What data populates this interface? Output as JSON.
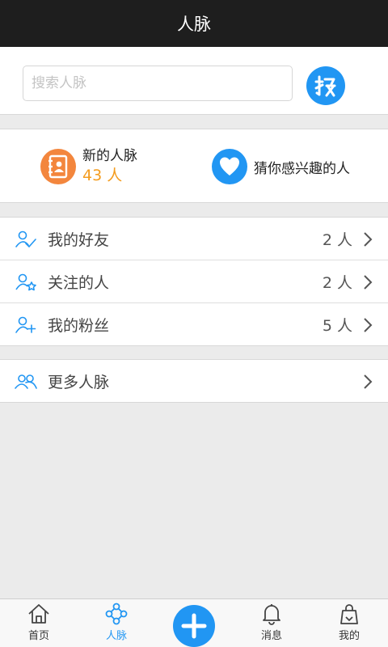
{
  "header": {
    "title": "人脉"
  },
  "search": {
    "placeholder": "搜索人脉",
    "value": "",
    "button_icon": "search-go-icon"
  },
  "featured": {
    "new_contacts": {
      "label": "新的人脉",
      "count": "43 人",
      "icon": "address-book-icon"
    },
    "guess": {
      "label": "猜你感兴趣的人",
      "icon": "heart-icon"
    }
  },
  "list": [
    {
      "label": "我的好友",
      "count": "2 人",
      "icon": "friend-check-icon"
    },
    {
      "label": "关注的人",
      "count": "2 人",
      "icon": "user-star-icon"
    },
    {
      "label": "我的粉丝",
      "count": "5 人",
      "icon": "user-plus-icon"
    }
  ],
  "more": {
    "label": "更多人脉",
    "icon": "users-group-icon"
  },
  "tabs": [
    {
      "label": "首页",
      "icon": "home-icon"
    },
    {
      "label": "人脉",
      "icon": "network-icon",
      "active": true
    },
    {
      "label": "",
      "icon": "plus-icon"
    },
    {
      "label": "消息",
      "icon": "bell-icon"
    },
    {
      "label": "我的",
      "icon": "bag-icon"
    }
  ],
  "colors": {
    "accent": "#2196f3",
    "orange": "#f3863d",
    "count_orange": "#f49c1e",
    "titlebar": "#1e1e1e"
  }
}
